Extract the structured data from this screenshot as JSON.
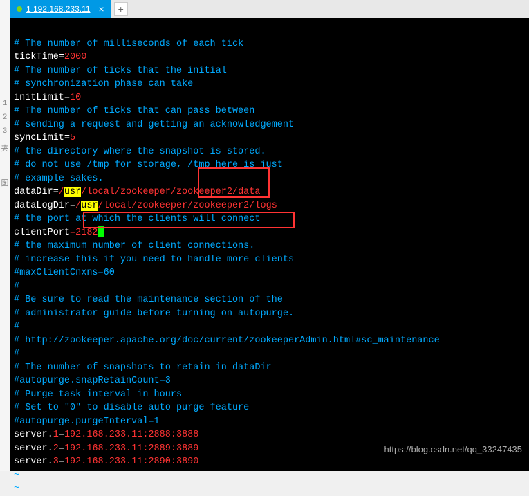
{
  "gutter": {
    "n1": "1",
    "n2": "2",
    "n3": "3",
    "k": "夹",
    "g": "图"
  },
  "tab": {
    "label": "1 192.168.233.11",
    "close": "×",
    "add": "+"
  },
  "lines": {
    "l1": "# The number of milliseconds of each tick",
    "l2a": "tickTime=",
    "l2b": "2000",
    "l3": "# The number of ticks that the initial",
    "l4": "# synchronization phase can take",
    "l5a": "initLimit=",
    "l5b": "10",
    "l6": "# The number of ticks that can pass between",
    "l7": "# sending a request and getting an acknowledgement",
    "l8a": "syncLimit=",
    "l8b": "5",
    "l9": "# the directory where the snapshot is stored.",
    "l10": "# do not use /tmp for storage, /tmp here is just",
    "l11": "# example sakes.",
    "l12a": "dataDir=",
    "l12b": "/",
    "l12c": "usr",
    "l12d": "/local/zookeeper/zookeeper2/data",
    "l13a": "dataLogDir=",
    "l13b": "/",
    "l13c": "usr",
    "l13d": "/local/zookeeper/zookeeper2/logs",
    "l14": "# the port at which the clients will connect",
    "l15a": "clientPort",
    "l15b": "=2182",
    "l16": "# the maximum number of client connections.",
    "l17": "# increase this if you need to handle more clients",
    "l18": "#maxClientCnxns=60",
    "l19": "#",
    "l20": "# Be sure to read the maintenance section of the",
    "l21": "# administrator guide before turning on autopurge.",
    "l22": "#",
    "l23": "# http://zookeeper.apache.org/doc/current/zookeeperAdmin.html#sc_maintenance",
    "l24": "#",
    "l25": "# The number of snapshots to retain in dataDir",
    "l26": "#autopurge.snapRetainCount=3",
    "l27": "# Purge task interval in hours",
    "l28": "# Set to \"0\" to disable auto purge feature",
    "l29": "#autopurge.purgeInterval=1",
    "l30a": "server.",
    "l30b": "1",
    "l30c": "=",
    "l30d": "192.168.233.11:2888:3888",
    "l31a": "server.",
    "l31b": "2",
    "l31c": "=",
    "l31d": "192.168.233.11:2889:3889",
    "l32a": "server.",
    "l32b": "3",
    "l32c": "=",
    "l32d": "192.168.233.11:2890:3890",
    "tilde": "~"
  },
  "watermark": "https://blog.csdn.net/qq_33247435"
}
